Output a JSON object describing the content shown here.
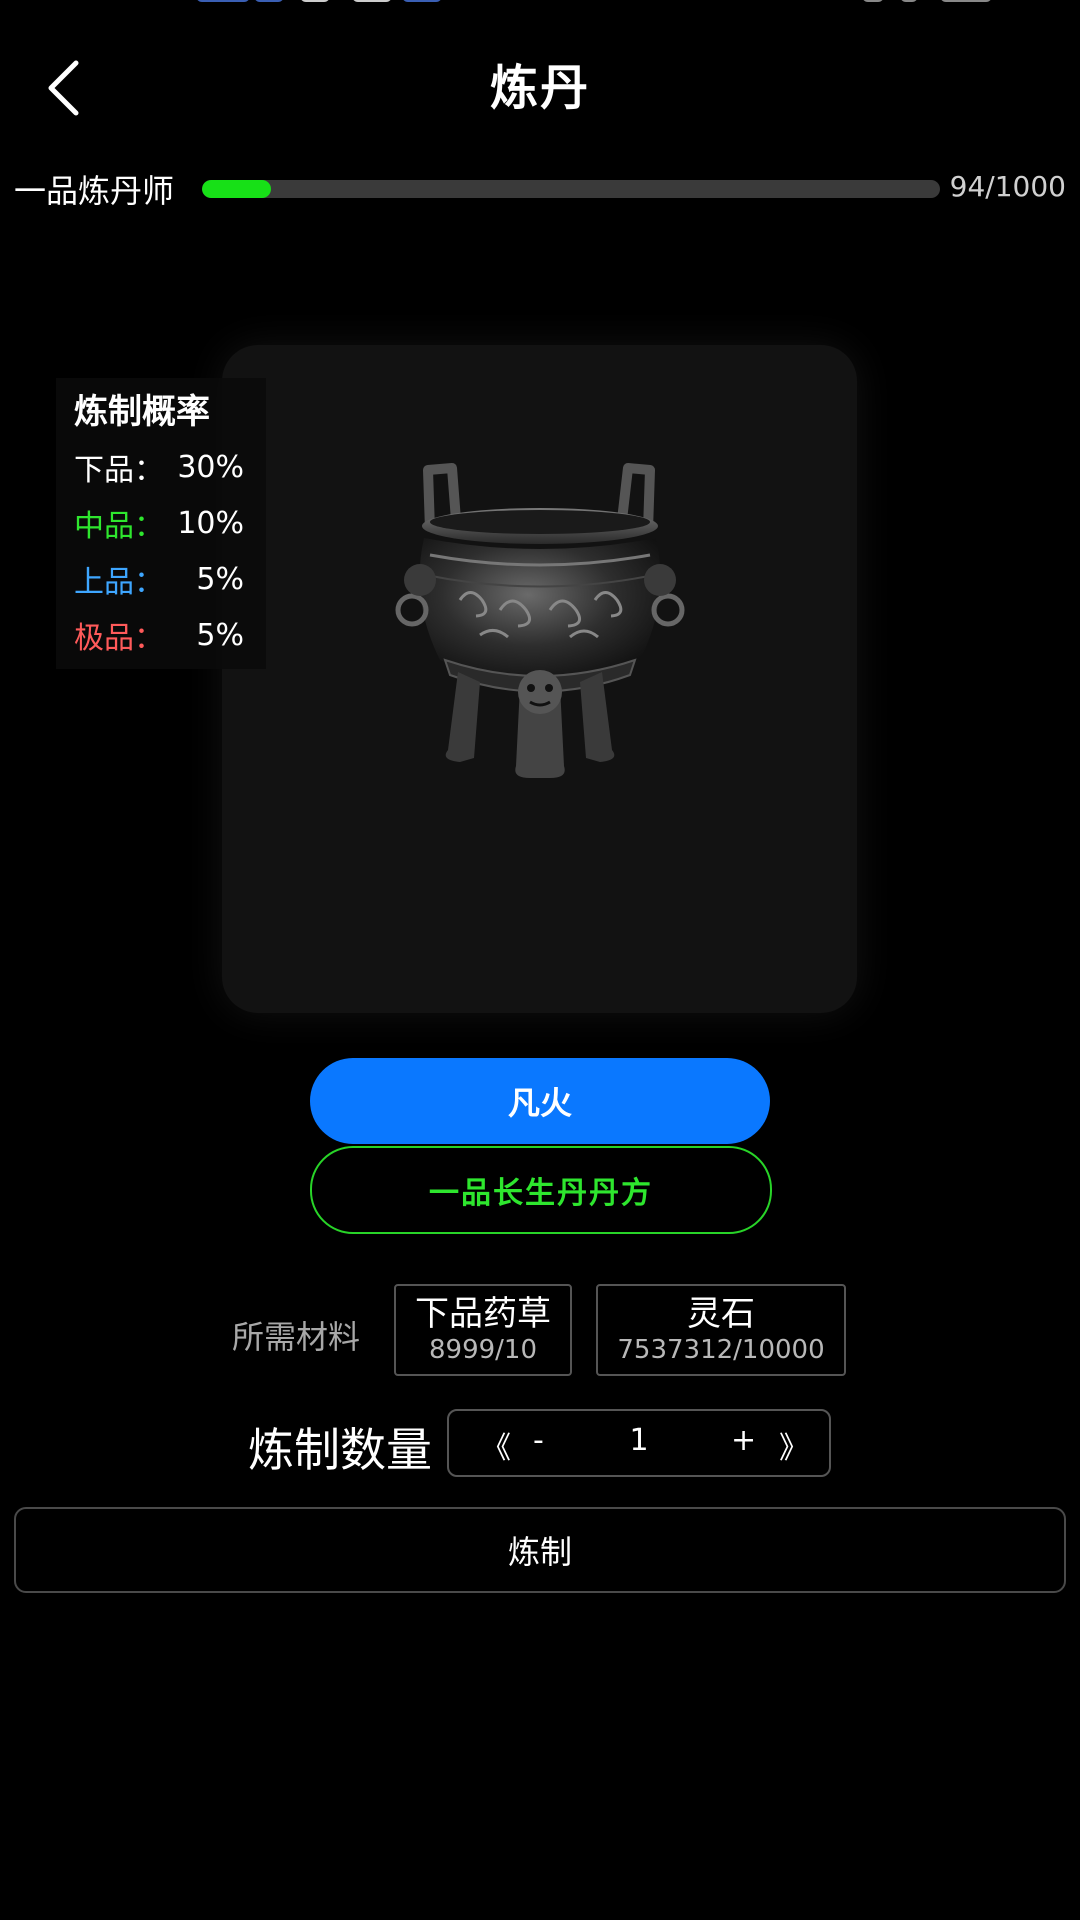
{
  "header": {
    "title": "炼丹"
  },
  "level": {
    "name": "一品炼丹师",
    "exp_text": "94/1000",
    "progress": 0.094,
    "fill_color": "#17e017"
  },
  "probability": {
    "title": "炼制概率",
    "rows": [
      {
        "name": "下品：",
        "value": "30%",
        "color": "#ffffff"
      },
      {
        "name": "中品：",
        "value": "10%",
        "color": "#2ee62e"
      },
      {
        "name": "上品：",
        "value": "5%",
        "color": "#3ea6ff"
      },
      {
        "name": "极品：",
        "value": "5%",
        "color": "#ff5a5a"
      }
    ]
  },
  "cauldron": {
    "icon": "bronze-cauldron-image"
  },
  "fire_button": {
    "label": "凡火",
    "color": "#0a78ff"
  },
  "recipe_button": {
    "label": "一品长生丹丹方",
    "color": "#2ee62e"
  },
  "materials": {
    "label": "所需材料",
    "items": [
      {
        "name": "下品药草",
        "count": "8999/10"
      },
      {
        "name": "灵石",
        "count": "7537312/10000"
      }
    ]
  },
  "quantity": {
    "label": "炼制数量",
    "first": "《",
    "minus": "-",
    "value": "1",
    "plus": "+",
    "last": "》"
  },
  "refine_button": {
    "label": "炼制"
  }
}
